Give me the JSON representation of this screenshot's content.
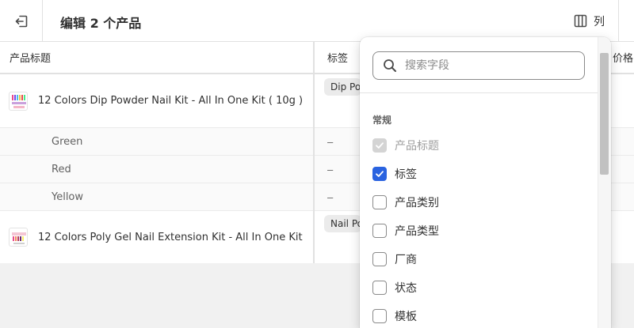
{
  "header": {
    "title": "编辑 2 个产品",
    "columns_label": "列"
  },
  "table": {
    "columns": {
      "title": "产品标题",
      "tags": "标签",
      "price": "价格"
    },
    "rows": [
      {
        "type": "product",
        "name": "12 Colors Dip Powder Nail Kit - All In One Kit ( 10g )",
        "tag": "Dip Powder"
      },
      {
        "type": "variant",
        "name": "Green",
        "tag": "–"
      },
      {
        "type": "variant",
        "name": "Red",
        "tag": "–"
      },
      {
        "type": "variant",
        "name": "Yellow",
        "tag": "–"
      },
      {
        "type": "product",
        "name": "12 Colors Poly Gel Nail Extension Kit - All In One Kit",
        "tag": "Nail Polish"
      }
    ]
  },
  "column_picker": {
    "search_placeholder": "搜索字段",
    "section": "常规",
    "options": [
      {
        "label": "产品标题",
        "state": "checked-disabled"
      },
      {
        "label": "标签",
        "state": "checked"
      },
      {
        "label": "产品类别",
        "state": "unchecked"
      },
      {
        "label": "产品类型",
        "state": "unchecked"
      },
      {
        "label": "厂商",
        "state": "unchecked"
      },
      {
        "label": "状态",
        "state": "unchecked"
      },
      {
        "label": "模板",
        "state": "unchecked"
      }
    ]
  },
  "colors": {
    "accent": "#2a63e0",
    "border": "#e1e1e1",
    "text": "#303030"
  }
}
